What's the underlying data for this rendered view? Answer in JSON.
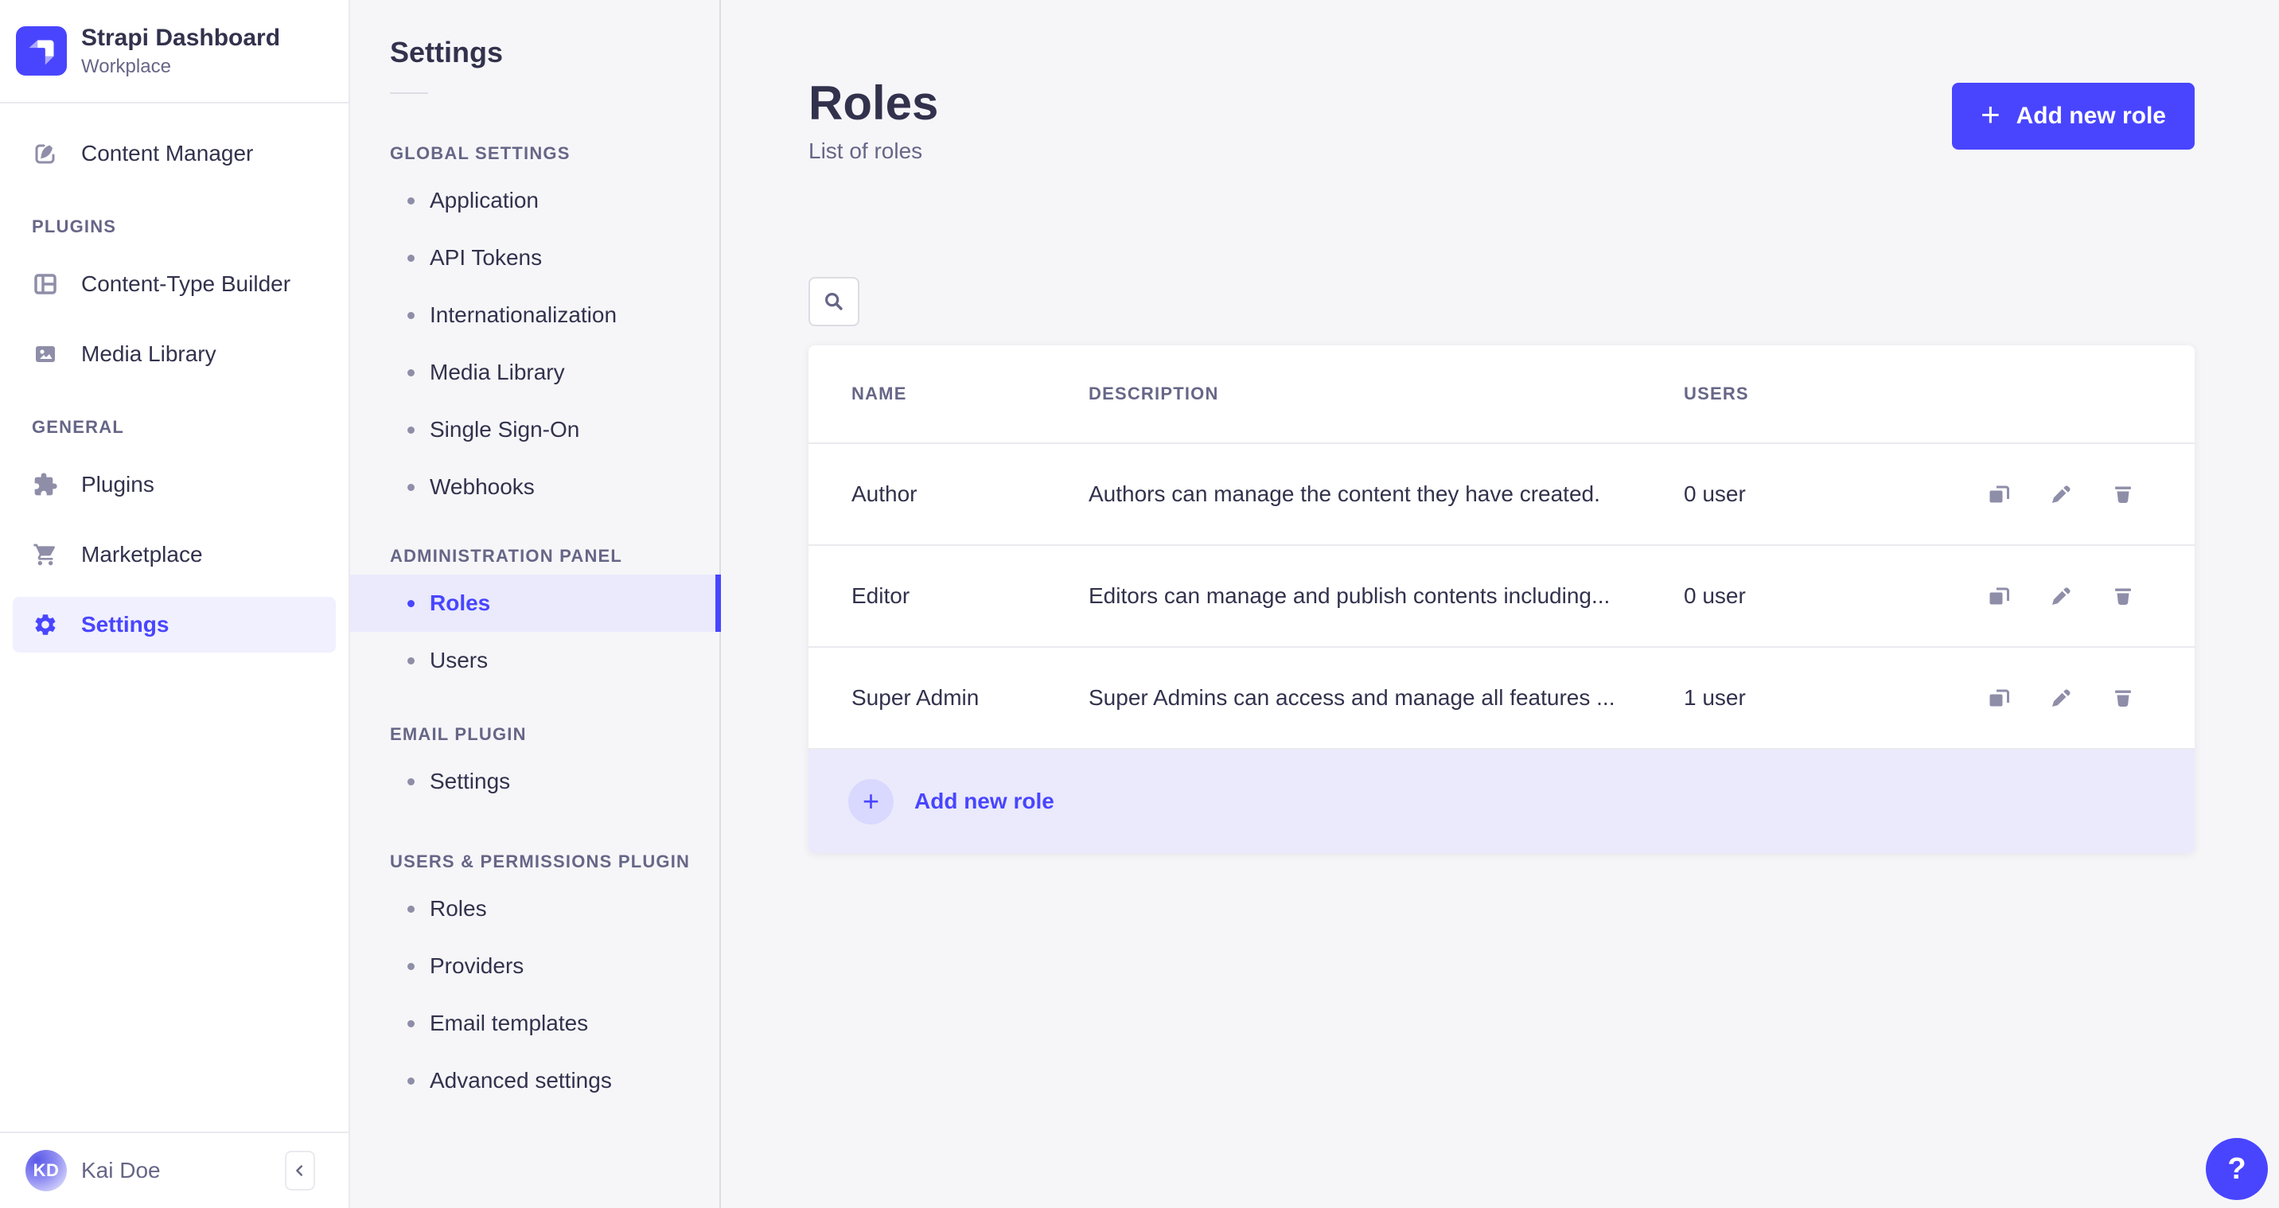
{
  "brand": {
    "name": "Strapi Dashboard",
    "workspace": "Workplace"
  },
  "sidebar": {
    "content_manager": "Content Manager",
    "sections": [
      {
        "label": "PLUGINS",
        "items": [
          "Content-Type Builder",
          "Media Library"
        ]
      },
      {
        "label": "GENERAL",
        "items": [
          "Plugins",
          "Marketplace",
          "Settings"
        ]
      }
    ],
    "user": {
      "initials": "KD",
      "name": "Kai Doe"
    }
  },
  "subnav": {
    "title": "Settings",
    "sections": [
      {
        "label": "GLOBAL SETTINGS",
        "items": [
          "Application",
          "API Tokens",
          "Internationalization",
          "Media Library",
          "Single Sign-On",
          "Webhooks"
        ]
      },
      {
        "label": "ADMINISTRATION PANEL",
        "items": [
          "Roles",
          "Users"
        ],
        "active_item": "Roles"
      },
      {
        "label": "EMAIL PLUGIN",
        "items": [
          "Settings"
        ]
      },
      {
        "label": "USERS & PERMISSIONS PLUGIN",
        "items": [
          "Roles",
          "Providers",
          "Email templates",
          "Advanced settings"
        ]
      }
    ]
  },
  "main": {
    "title": "Roles",
    "subtitle": "List of roles",
    "add_button_label": "Add new role",
    "table": {
      "headers": [
        "NAME",
        "DESCRIPTION",
        "USERS"
      ],
      "rows": [
        {
          "name": "Author",
          "description": "Authors can manage the content they have created.",
          "users": "0 user"
        },
        {
          "name": "Editor",
          "description": "Editors can manage and publish contents including...",
          "users": "0 user"
        },
        {
          "name": "Super Admin",
          "description": "Super Admins can access and manage all features ...",
          "users": "1 user"
        }
      ],
      "footer_add_label": "Add new role"
    }
  },
  "icons": {
    "plus": "+",
    "help": "?"
  },
  "colors": {
    "primary": "#4945ff",
    "primary_light_bg": "#eaeafc",
    "primary_circle_bg": "#d9d8ff",
    "text_dark": "#32324d",
    "text_gray": "#666687",
    "icon_gray": "#8e8ea9",
    "border_light": "#eaeaef",
    "border_mid": "#dcdce4",
    "page_bg": "#f6f6f9"
  }
}
